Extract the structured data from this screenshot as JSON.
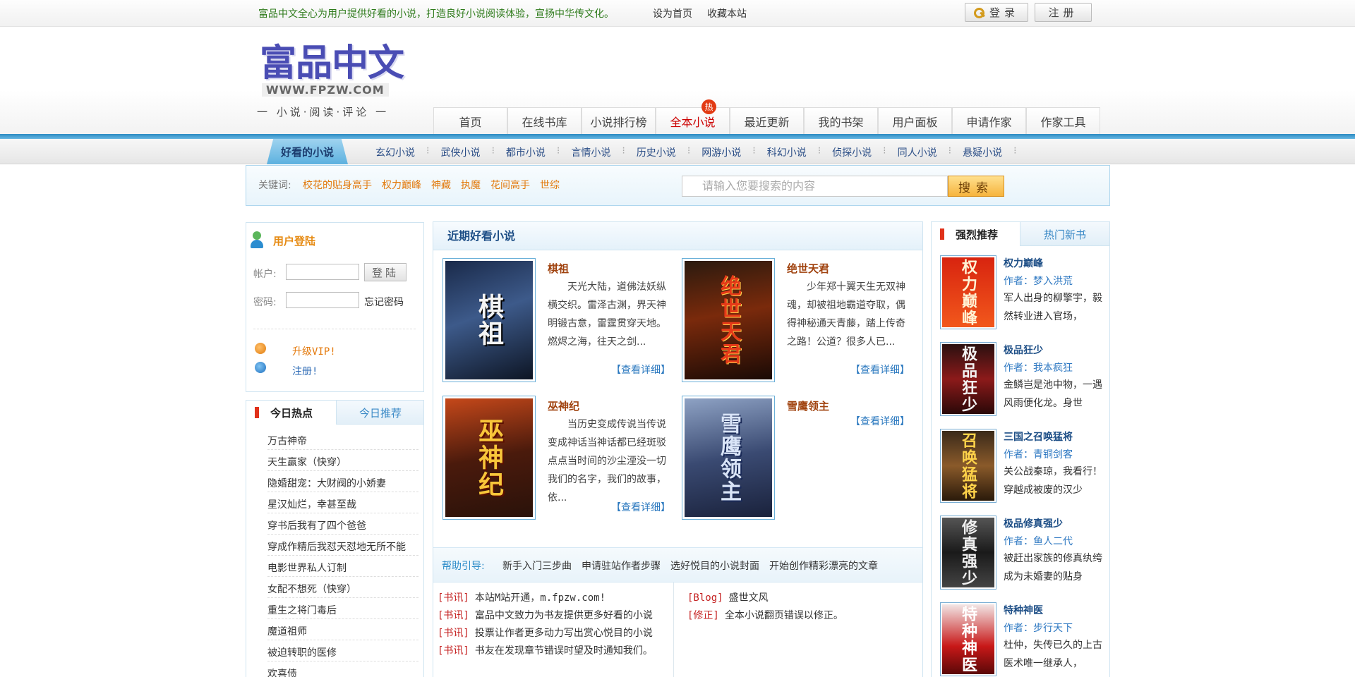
{
  "topbar": {
    "slogan": "富品中文全心为用户提供好看的小说，打造良好小说阅读体验，宣扬中华传文化。",
    "set_home": "设为首页",
    "bookmark": "收藏本站",
    "login": "登录",
    "register": "注册"
  },
  "logo": {
    "main": "富品中文",
    "url": "WWW.FPZW.COM",
    "sub": "一 小说·阅读·评论 一"
  },
  "nav": {
    "items": [
      "首页",
      "在线书库",
      "小说排行榜",
      "全本小说",
      "最近更新",
      "我的书架",
      "用户面板",
      "申请作家",
      "作家工具"
    ],
    "hot_badge": "热"
  },
  "subbar": {
    "tab": "好看的小说",
    "items": [
      "玄幻小说",
      "武侠小说",
      "都市小说",
      "言情小说",
      "历史小说",
      "网游小说",
      "科幻小说",
      "侦探小说",
      "同人小说",
      "悬疑小说"
    ]
  },
  "search": {
    "kw_label": "关键词:",
    "keywords": [
      "校花的贴身高手",
      "权力巅峰",
      "神藏",
      "执魔",
      "花间高手",
      "世综"
    ],
    "placeholder": "请输入您要搜索的内容",
    "button": "搜索"
  },
  "login_box": {
    "title": "用户登陆",
    "account_label": "帐户:",
    "password_label": "密码:",
    "submit": "登陆",
    "forgot": "忘记密码",
    "vip": "升级VIP!",
    "reg": "注册!"
  },
  "hot_today": {
    "tab_active": "今日热点",
    "tab_other": "今日推荐",
    "items": [
      "万古神帝",
      "天生赢家（快穿）",
      "隐婚甜宠：大财阀的小娇妻",
      "星汉灿烂，幸甚至哉",
      "穿书后我有了四个爸爸",
      "穿成作精后我怼天怼地无所不能",
      "电影世界私人订制",
      "女配不想死（快穿）",
      "重生之将门毒后",
      "魔道祖师",
      "被迫转职的医修",
      "欢喜债"
    ]
  },
  "recent": {
    "title": "近期好看小说",
    "more": "【查看详细】",
    "books": [
      {
        "title": "棋祖",
        "cover": "棋祖",
        "desc": "天光大陆，道佛法妖纵横交织。雷泽古渊，界天神明锻古意，雷霆贯穿天地。燃烬之海，往天之剑..."
      },
      {
        "title": "绝世天君",
        "cover": "绝世天君",
        "desc": "少年郑十翼天生无双神魂，却被祖地霸道夺取，偶得神秘通天青藤，踏上传奇之路！公道？很多人已..."
      },
      {
        "title": "巫神纪",
        "cover": "巫神纪",
        "desc": "当历史变成传说当传说变成神话当神话都已经斑驳点点当时间的沙尘湮没一切我们的名字，我们的故事，依..."
      },
      {
        "title": "雪鹰领主",
        "cover": "雪鹰领主",
        "desc": ""
      }
    ]
  },
  "help": {
    "label": "帮助引导:",
    "items": [
      "新手入门三步曲",
      "申请驻站作者步骤",
      "选好悦目的小说封面",
      "开始创作精彩漂亮的文章"
    ]
  },
  "news": {
    "left": [
      {
        "tag": "[书讯]",
        "text": "本站M站开通，m.fpzw.com!"
      },
      {
        "tag": "[书讯]",
        "text": "富品中文致力为书友提供更多好看的小说"
      },
      {
        "tag": "[书讯]",
        "text": "投票让作者更多动力写出赏心悦目的小说"
      },
      {
        "tag": "[书讯]",
        "text": "书友在发现章节错误时望及时通知我们。"
      }
    ],
    "right": [
      {
        "tag": "[Blog]",
        "text": "盛世文风"
      },
      {
        "tag": "[修正]",
        "text": "全本小说翻页错误以修正。"
      }
    ]
  },
  "recommend": {
    "tab_active": "强烈推荐",
    "tab_other": "热门新书",
    "books": [
      {
        "title": "权力巅峰",
        "author": "作者：梦入洪荒",
        "desc": "军人出身的柳擎宇，毅然转业进入官场，",
        "cover": "权力巅峰"
      },
      {
        "title": "极品狂少",
        "author": "作者：我本疯狂",
        "desc": "金鳞岂是池中物，一遇风雨便化龙。身世",
        "cover": "极品狂少"
      },
      {
        "title": "三国之召唤猛将",
        "author": "作者：青铜剑客",
        "desc": "关公战秦琼，我看行！穿越成被废的汉少",
        "cover": "召唤猛将"
      },
      {
        "title": "极品修真强少",
        "author": "作者：鱼人二代",
        "desc": "被赶出家族的修真纨绔成为未婚妻的贴身",
        "cover": "修真强少"
      },
      {
        "title": "特种神医",
        "author": "作者：步行天下",
        "desc": "杜仲，失传已久的上古医术唯一继承人，",
        "cover": "特种神医"
      }
    ]
  },
  "colors": {
    "accent_blue": "#2b8bc2",
    "orange": "#e2790b",
    "red": "#c52222"
  }
}
